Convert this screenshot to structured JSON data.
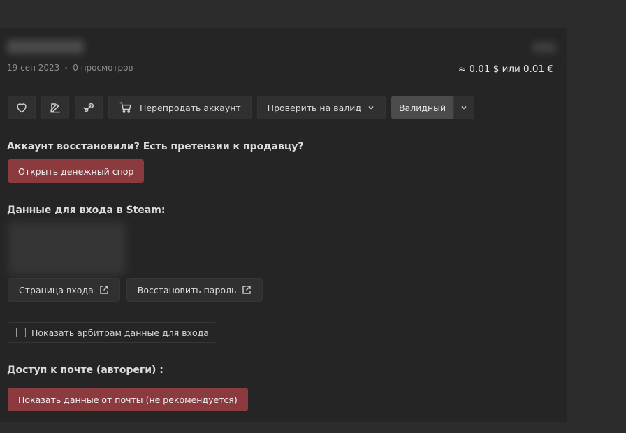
{
  "meta": {
    "date": "19 сен 2023",
    "views": "0 просмотров"
  },
  "price": "≈ 0.01 $ или 0.01 €",
  "toolbar": {
    "resell_label": "Перепродать аккаунт",
    "check_label": "Проверить на валид",
    "status_label": "Валидный"
  },
  "dispute": {
    "heading": "Аккаунт восстановили? Есть претензии к продавцу?",
    "button": "Открыть денежный спор"
  },
  "steam": {
    "heading": "Данные для входа в Steam:",
    "login_page": "Страница входа",
    "restore_password": "Восстановить пароль"
  },
  "arbiter": {
    "label": "Показать арбитрам данные для входа",
    "checked": false
  },
  "mail": {
    "heading": "Доступ к почте (автореги) :",
    "button": "Показать данные от почты (не рекомендуется)"
  },
  "colors": {
    "danger": "#8b3a3e",
    "status_bg": "#4b4b4b",
    "accent_dot": "#3c8a5a"
  }
}
